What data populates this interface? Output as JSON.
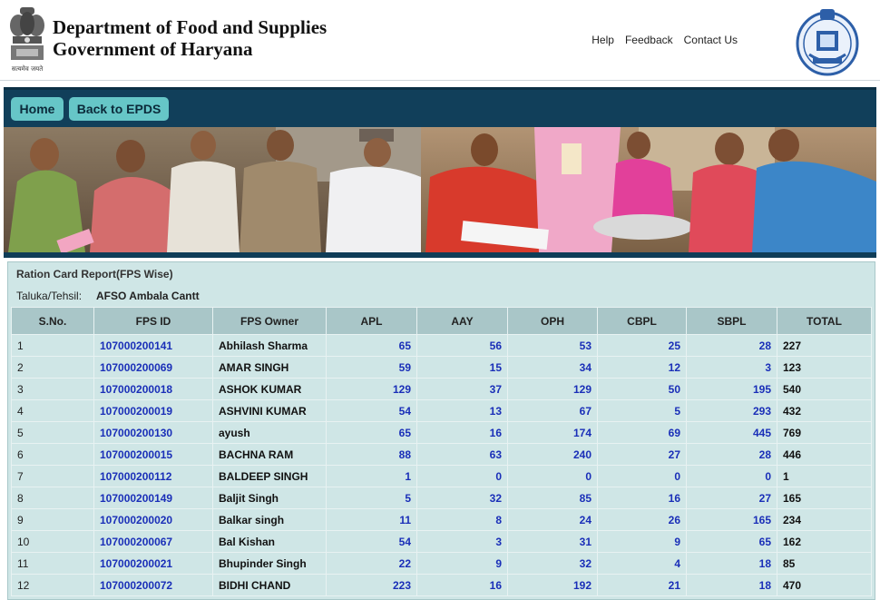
{
  "header": {
    "title_line1": "Department of Food and Supplies",
    "title_line2": "Government of Haryana",
    "links": [
      "Help",
      "Feedback",
      "Contact Us"
    ],
    "emblem_left_caption": "सत्यमेव जयते"
  },
  "nav": {
    "home": "Home",
    "back": "Back to EPDS"
  },
  "report": {
    "title": "Ration Card Report(FPS Wise)",
    "taluka_label": "Taluka/Tehsil:",
    "taluka_value": "AFSO Ambala Cantt",
    "columns": [
      "S.No.",
      "FPS ID",
      "FPS Owner",
      "APL",
      "AAY",
      "OPH",
      "CBPL",
      "SBPL",
      "TOTAL"
    ],
    "rows": [
      [
        "1",
        "107000200141",
        "Abhilash Sharma",
        "65",
        "56",
        "53",
        "25",
        "28",
        "227"
      ],
      [
        "2",
        "107000200069",
        "AMAR SINGH",
        "59",
        "15",
        "34",
        "12",
        "3",
        "123"
      ],
      [
        "3",
        "107000200018",
        "ASHOK KUMAR",
        "129",
        "37",
        "129",
        "50",
        "195",
        "540"
      ],
      [
        "4",
        "107000200019",
        "ASHVINI KUMAR",
        "54",
        "13",
        "67",
        "5",
        "293",
        "432"
      ],
      [
        "5",
        "107000200130",
        "ayush",
        "65",
        "16",
        "174",
        "69",
        "445",
        "769"
      ],
      [
        "6",
        "107000200015",
        "BACHNA RAM",
        "88",
        "63",
        "240",
        "27",
        "28",
        "446"
      ],
      [
        "7",
        "107000200112",
        "BALDEEP SINGH",
        "1",
        "0",
        "0",
        "0",
        "0",
        "1"
      ],
      [
        "8",
        "107000200149",
        "Baljit Singh",
        "5",
        "32",
        "85",
        "16",
        "27",
        "165"
      ],
      [
        "9",
        "107000200020",
        "Balkar singh",
        "11",
        "8",
        "24",
        "26",
        "165",
        "234"
      ],
      [
        "10",
        "107000200067",
        "Bal Kishan",
        "54",
        "3",
        "31",
        "9",
        "65",
        "162"
      ],
      [
        "11",
        "107000200021",
        "Bhupinder Singh",
        "22",
        "9",
        "32",
        "4",
        "18",
        "85"
      ],
      [
        "12",
        "107000200072",
        "BIDHI CHAND",
        "223",
        "16",
        "192",
        "21",
        "18",
        "470"
      ]
    ]
  }
}
